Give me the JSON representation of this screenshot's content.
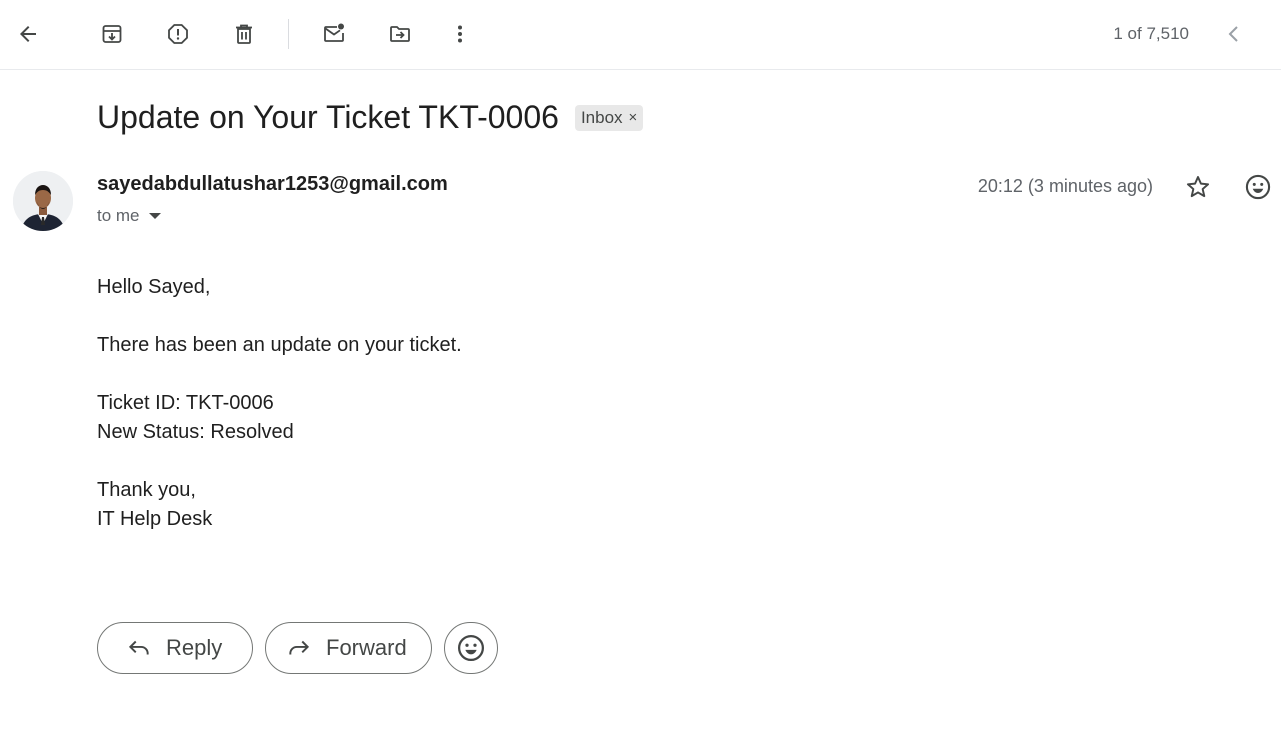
{
  "toolbar": {
    "pager": "1 of 7,510",
    "icons": {
      "back": "arrow-back-icon",
      "archive": "archive-icon",
      "spam": "report-spam-icon",
      "delete": "trash-icon",
      "unread": "mark-unread-icon",
      "move": "move-to-icon",
      "more": "more-vert-icon",
      "prev": "chevron-left-icon"
    }
  },
  "email": {
    "subject": "Update on Your Ticket TKT-0006",
    "label": "Inbox",
    "label_remove": "×",
    "sender": "sayedabdullatushar1253@gmail.com",
    "recipient": "to me",
    "timestamp": "20:12 (3 minutes ago)",
    "body": {
      "greeting": "Hello Sayed,",
      "intro": "There has been an update on your ticket.",
      "ticket_id": "Ticket ID: TKT-0006",
      "new_status": "New Status: Resolved",
      "closing": "Thank you,",
      "signature": "IT Help Desk"
    }
  },
  "actions": {
    "reply": "Reply",
    "forward": "Forward"
  },
  "colors": {
    "icon": "#444746",
    "muted": "#5f6368",
    "chip_bg": "#e8e8e8",
    "border": "#747775"
  }
}
